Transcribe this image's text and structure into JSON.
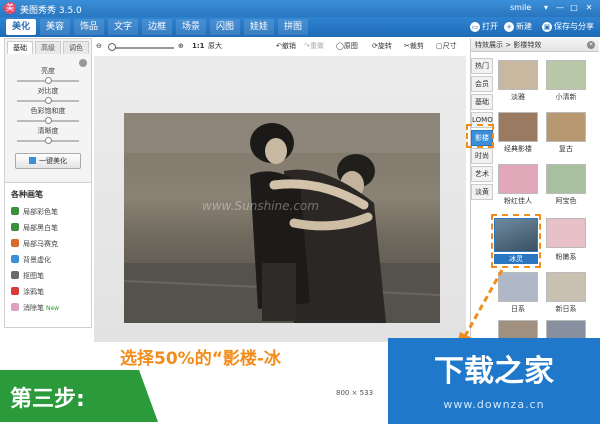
{
  "app": {
    "title": "美图秀秀 3.5.0",
    "logo_glyph": "美",
    "user": "smile",
    "win_controls": [
      "▾",
      "—",
      "□",
      "✕"
    ]
  },
  "menu": {
    "tabs": [
      "美化",
      "美容",
      "饰品",
      "文字",
      "边框",
      "场景",
      "闪图",
      "娃娃",
      "拼图"
    ],
    "active": "美化"
  },
  "top_actions": {
    "open": "打开",
    "new": "新建",
    "save_share": "保存与分享"
  },
  "left_panel": {
    "tabs": [
      "基础",
      "高级",
      "调色"
    ],
    "active_tab": "基础",
    "sliders": [
      {
        "label": "亮度",
        "value": 0.5
      },
      {
        "label": "对比度",
        "value": 0.5
      },
      {
        "label": "色彩饱和度",
        "value": 0.5
      },
      {
        "label": "清晰度",
        "value": 0.5
      }
    ],
    "beautify_button": "一键美化",
    "brushes_title": "各种画笔",
    "brushes": [
      {
        "label": "局部彩色笔",
        "icon": "color-brush-icon",
        "color": "#3a8f3a"
      },
      {
        "label": "局部黑白笔",
        "icon": "bw-brush-icon",
        "color": "#3a8f3a"
      },
      {
        "label": "局部马赛克",
        "icon": "mosaic-icon",
        "color": "#d86a2a"
      },
      {
        "label": "背景虚化",
        "icon": "blur-icon",
        "color": "#3a8fd8"
      },
      {
        "label": "抠图笔",
        "icon": "cutout-icon",
        "color": "#6a6a6a"
      },
      {
        "label": "涂鸦笔",
        "icon": "doodle-icon",
        "color": "#d83a3a"
      },
      {
        "label": "消除笔",
        "icon": "eraser-icon",
        "color": "#e0a0c0",
        "badge": "New"
      }
    ]
  },
  "toolbar": {
    "zoom_ratio": "1:1",
    "original_size": "原大",
    "undo": "撤销",
    "redo": "重做",
    "original": "原图",
    "rotate": "旋转",
    "crop": "裁剪",
    "size": "尺寸"
  },
  "canvas": {
    "watermark": "www.Sunshine.com"
  },
  "status": {
    "dimensions": "800 × 533"
  },
  "right_panel": {
    "breadcrumb": "特效展示 > 影楼特效",
    "categories": [
      "热门",
      "会员",
      "基础",
      "LOMO",
      "影楼",
      "时尚",
      "艺术",
      "淡黄"
    ],
    "active_category": "影楼",
    "effects": [
      {
        "label": "淡雅",
        "color": "#c9b8a0"
      },
      {
        "label": "小清新",
        "color": "#b8c8a8"
      },
      {
        "label": "经典影楼",
        "color": "#9a7a60"
      },
      {
        "label": "复古",
        "color": "#b89870"
      },
      {
        "label": "粉红佳人",
        "color": "#e0a8b8"
      },
      {
        "label": "阿宝色",
        "color": "#a8c0a0"
      },
      {
        "label": "冰灵",
        "color": "#6e8aa0"
      },
      {
        "label": "粉嫩系",
        "color": "#e8c0c8"
      },
      {
        "label": "日系",
        "color": "#b0b8c8"
      },
      {
        "label": "新日系",
        "color": "#c8c0b0"
      },
      {
        "label": "",
        "color": "#a09080"
      },
      {
        "label": "",
        "color": "#8890a0"
      }
    ],
    "selected_effect": "冰灵"
  },
  "overlay": {
    "caption": "选择50%的“影楼-冰",
    "step": "第三步:",
    "brand": "下载之家",
    "brand_url": "www.downza.cn"
  },
  "colors": {
    "accent": "#2a76c0",
    "highlight": "#f28c1a",
    "step_green": "#2a9a3a",
    "brand_blue": "#1f78c9"
  }
}
